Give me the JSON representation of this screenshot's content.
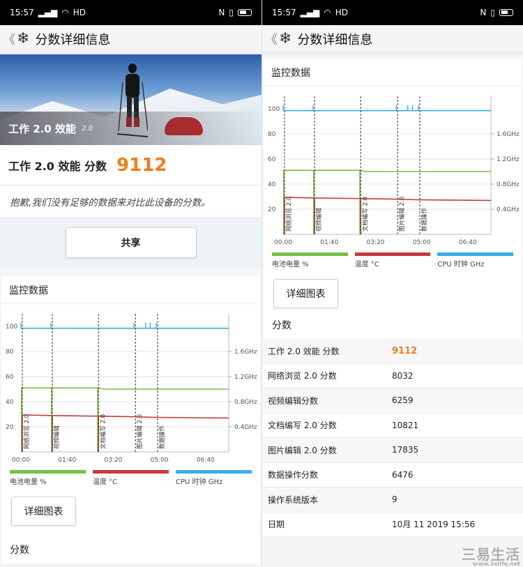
{
  "status": {
    "time": "15:57",
    "network": "HD"
  },
  "header": {
    "back": "《",
    "title": "分数详细信息"
  },
  "hero": {
    "label": "工作 2.0 效能",
    "version": "2.0"
  },
  "score": {
    "label": "工作 2.0 效能 分数",
    "value": "9112"
  },
  "note": "抱歉,我们没有足够的数据来对比此设备的分数。",
  "share_label": "共享",
  "monitor": {
    "title": "监控数据",
    "detail_button": "详细图表",
    "legend": [
      {
        "label": "电池电量 %",
        "color": "#76c043"
      },
      {
        "label": "温度 °C",
        "color": "#c8393b"
      },
      {
        "label": "CPU 时钟 GHz",
        "color": "#3aaee0"
      }
    ]
  },
  "scores_section": {
    "title": "分数"
  },
  "table": [
    {
      "k": "工作 2.0 效能 分数",
      "v": "9112",
      "accent": true
    },
    {
      "k": "网络浏览 2.0 分数",
      "v": "8032"
    },
    {
      "k": "视频编辑分数",
      "v": "6259"
    },
    {
      "k": "文档编写 2.0 分数",
      "v": "10821"
    },
    {
      "k": "图片编辑 2.0 分数",
      "v": "17835"
    },
    {
      "k": "数据操作分数",
      "v": "6476"
    },
    {
      "k": "操作系统版本",
      "v": "9"
    },
    {
      "k": "日期",
      "v": "10月 11 2019 15:56"
    }
  ],
  "watermark": {
    "main": "三易生活",
    "sub": "www.3elife.net"
  },
  "chart_data": {
    "type": "line",
    "x_ticks": [
      "00:00",
      "01:40",
      "03:20",
      "05:00",
      "06:40"
    ],
    "xlim": [
      0,
      450
    ],
    "y_left_ticks": [
      20,
      40,
      60,
      80,
      100
    ],
    "y_right_ticks": [
      "0.4GHz",
      "0.8GHz",
      "1.2GHz",
      "1.6GHz"
    ],
    "ylim": [
      0,
      110
    ],
    "markers": [
      {
        "x": 0,
        "label": "网络浏览 2.0"
      },
      {
        "x": 65,
        "label": "视频编辑"
      },
      {
        "x": 165,
        "label": "文档编写 2.0"
      },
      {
        "x": 245,
        "label": "图片编辑 2.0"
      },
      {
        "x": 293,
        "label": "数据操作"
      }
    ],
    "series": [
      {
        "name": "电池电量 %",
        "color": "#76c043",
        "x": [
          0,
          65,
          165,
          180,
          450
        ],
        "y": [
          51,
          51,
          51,
          50,
          50
        ]
      },
      {
        "name": "温度 °C",
        "color": "#c8393b",
        "x": [
          0,
          65,
          165,
          245,
          293,
          450
        ],
        "y": [
          29.5,
          29,
          28.5,
          28,
          27.5,
          27
        ]
      },
      {
        "name": "CPU 时钟 GHz",
        "color": "#3aaee0",
        "x": [
          0,
          450
        ],
        "y": [
          1.97,
          1.97
        ],
        "spikes": [
          0,
          65,
          245,
          270,
          280,
          293
        ]
      }
    ]
  }
}
